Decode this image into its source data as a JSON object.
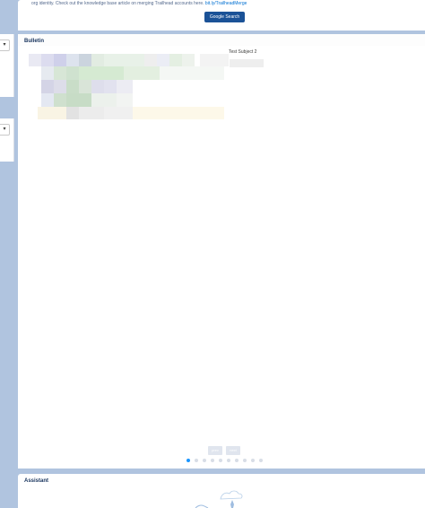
{
  "top_card": {
    "text": "org identity. Check out the knowledge base article on merging Trailhead accounts here.",
    "link": "bit.ly/TrailheadMerge",
    "button_label": "Google Search"
  },
  "bulletin": {
    "title": "Bulletin",
    "subject": "Test Subject 2",
    "prev_label": "prev",
    "next_label": "next",
    "page_count": 10,
    "active_page": 1
  },
  "assistant": {
    "title": "Assistant"
  },
  "colors": {
    "button": "#1b5297",
    "link": "#0070d2",
    "active_dot": "#1b96ff"
  }
}
